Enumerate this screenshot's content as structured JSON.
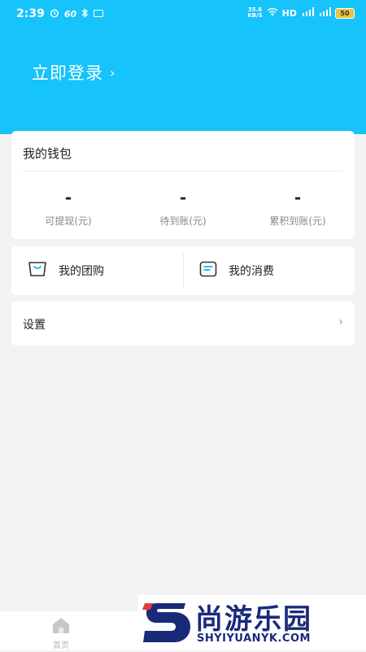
{
  "status_bar": {
    "time": "2:39",
    "net_label": "60",
    "speed_value": "35.6",
    "speed_unit": "KB/S",
    "hd_label": "HD",
    "battery": "50"
  },
  "header": {
    "login_label": "立即登录",
    "chevron": "›"
  },
  "wallet": {
    "title": "我的钱包",
    "stats": [
      {
        "value": "-",
        "label": "可提现(元)"
      },
      {
        "value": "-",
        "label": "待到账(元)"
      },
      {
        "value": "-",
        "label": "累积到账(元)"
      }
    ]
  },
  "actions": {
    "group_buy": "我的团购",
    "consumption": "我的消费"
  },
  "settings": {
    "label": "设置",
    "chevron": "›"
  },
  "bottom_nav": {
    "home_label": "首页"
  },
  "watermark": {
    "text": "尚游乐园",
    "url": "SHYIYUANYK.COM"
  },
  "colors": {
    "header": "#16c3fa",
    "accent_icon": "#1fb4e6",
    "background": "#f3f3f4"
  },
  "icons": [
    "alarm-icon",
    "bluetooth-icon",
    "wifi-icon",
    "signal-icon",
    "battery-icon",
    "bag-icon",
    "receipt-icon",
    "chevron-right-icon",
    "home-icon"
  ]
}
